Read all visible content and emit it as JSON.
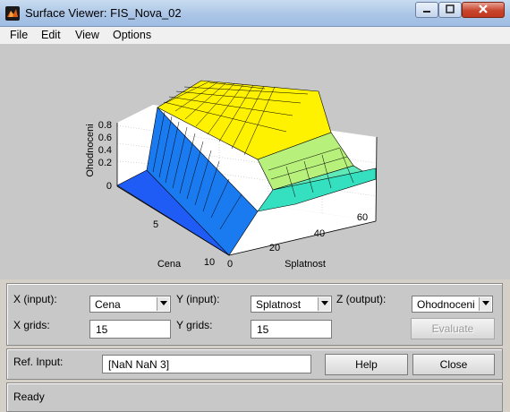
{
  "window": {
    "title": "Surface Viewer: FIS_Nova_02"
  },
  "menu": [
    "File",
    "Edit",
    "View",
    "Options"
  ],
  "chart_data": {
    "type": "surface",
    "zlabel": "Ohodnoceni",
    "xlabel": "Splatnost",
    "ylabel": "Cena",
    "z_ticks": [
      "0",
      "0.2",
      "0.4",
      "0.6",
      "0.8"
    ],
    "x_ticks": [
      "0",
      "20",
      "40",
      "60"
    ],
    "y_ticks": [
      "5",
      "10"
    ],
    "grid": true,
    "zlim": [
      0,
      0.9
    ],
    "description": "Plateau near 0.85 at low Cena, stepping down to ~0.5 at high Splatnost and ~0 at high Cena"
  },
  "controls": {
    "x_input_label": "X (input):",
    "x_input_value": "Cena",
    "y_input_label": "Y (input):",
    "y_input_value": "Splatnost",
    "z_output_label": "Z (output):",
    "z_output_value": "Ohodnoceni",
    "x_grids_label": "X grids:",
    "x_grids_value": "15",
    "y_grids_label": "Y grids:",
    "y_grids_value": "15",
    "evaluate_label": "Evaluate"
  },
  "ref": {
    "label": "Ref. Input:",
    "value": "[NaN NaN 3]",
    "help_label": "Help",
    "close_label": "Close"
  },
  "status": {
    "text": "Ready"
  }
}
